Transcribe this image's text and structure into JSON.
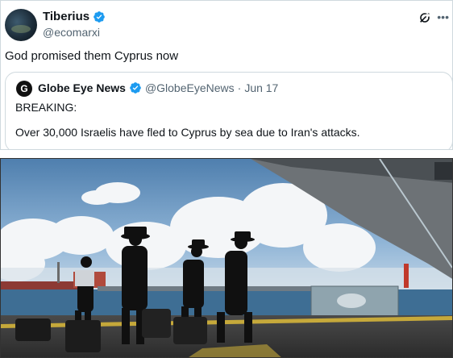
{
  "tweet": {
    "author_name": "Tiberius",
    "author_handle": "@ecomarxi",
    "text": "God promised them Cyprus now",
    "more_label": "•••"
  },
  "quoted_tweet": {
    "logo_letter": "G",
    "author_name": "Globe Eye News",
    "author_handle": "@GlobeEyeNews",
    "separator": "·",
    "date": "Jun 17",
    "breaking_label": "BREAKING:",
    "body": "Over 30,000 Israelis have fled to Cyprus by sea due to Iran's attacks."
  },
  "colors": {
    "verified": "#1d9bf0",
    "secondary_text": "#536471",
    "border": "#cfd9de"
  },
  "icons": {
    "verified": "verified-badge-icon",
    "grok": "grok-icon",
    "more": "more-icon"
  },
  "photo": {
    "description_visible": false
  }
}
